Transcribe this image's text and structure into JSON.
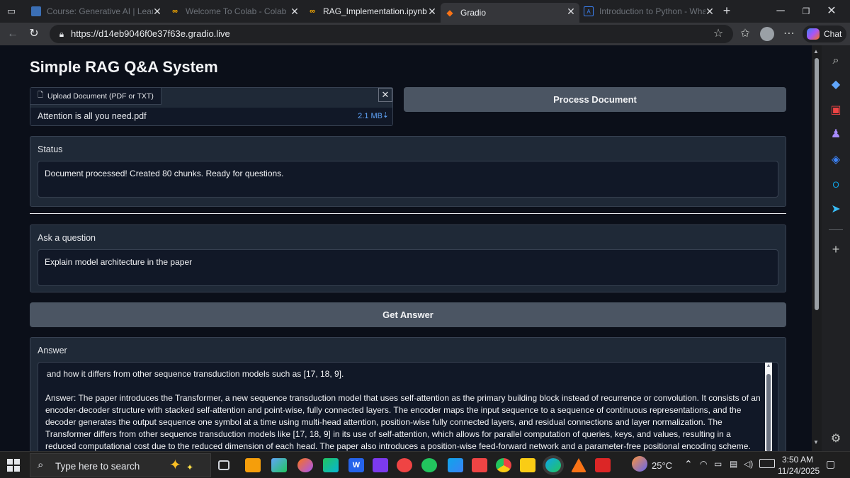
{
  "browser": {
    "tabs": [
      {
        "title": "Course: Generative AI | Learnin",
        "favicon_color": "#3b6fb5",
        "active": false
      },
      {
        "title": "Welcome To Colab - Colab",
        "favicon_color": "#f9ab00",
        "active": false
      },
      {
        "title": "RAG_Implementation.ipynb - C",
        "favicon_color": "#f9ab00",
        "active": false
      },
      {
        "title": "Gradio",
        "favicon_color": "#f97316",
        "active": true
      },
      {
        "title": "Introduction to Python - What",
        "favicon_color": "#3b82f6",
        "active": false
      }
    ],
    "url": "https://d14eb9046f0e37f63e.gradio.live",
    "chat_label": "Chat"
  },
  "app": {
    "title": "Simple RAG Q&A System",
    "upload": {
      "label": "Upload Document (PDF or TXT)",
      "file_name": "Attention is all you need.pdf",
      "file_size": "2.1 MB"
    },
    "process_button": "Process Document",
    "status": {
      "label": "Status",
      "value": "Document processed! Created 80 chunks. Ready for questions."
    },
    "question": {
      "label": "Ask a question",
      "value": "Explain model architecture in the paper"
    },
    "answer_button": "Get Answer",
    "answer": {
      "label": "Answer",
      "line1": "and how it differs from other sequence transduction models such as [17, 18, 9].",
      "body": "Answer: The paper introduces the Transformer, a new sequence transduction model that uses self-attention as the primary building block instead of recurrence or convolution. It consists of an encoder-decoder structure with stacked self-attention and point-wise, fully connected layers. The encoder maps the input sequence to a sequence of continuous representations, and the decoder generates the output sequence one symbol at a time using multi-head attention, position-wise fully connected layers, and residual connections and layer normalization. The Transformer differs from other sequence transduction models like [17, 18, 9] in its use of self-attention, which allows for parallel computation of queries, keys, and values, resulting in a reduced computational cost due to the reduced dimension of each head. The paper also introduces a position-wise feed-forward network and a parameter-free positional encoding scheme. The authors credit Niki, Llion, and Lukasz for their"
    }
  },
  "taskbar": {
    "search_placeholder": "Type here to search",
    "weather": "25°C",
    "time": "3:50 AM",
    "date": "11/24/2025"
  }
}
